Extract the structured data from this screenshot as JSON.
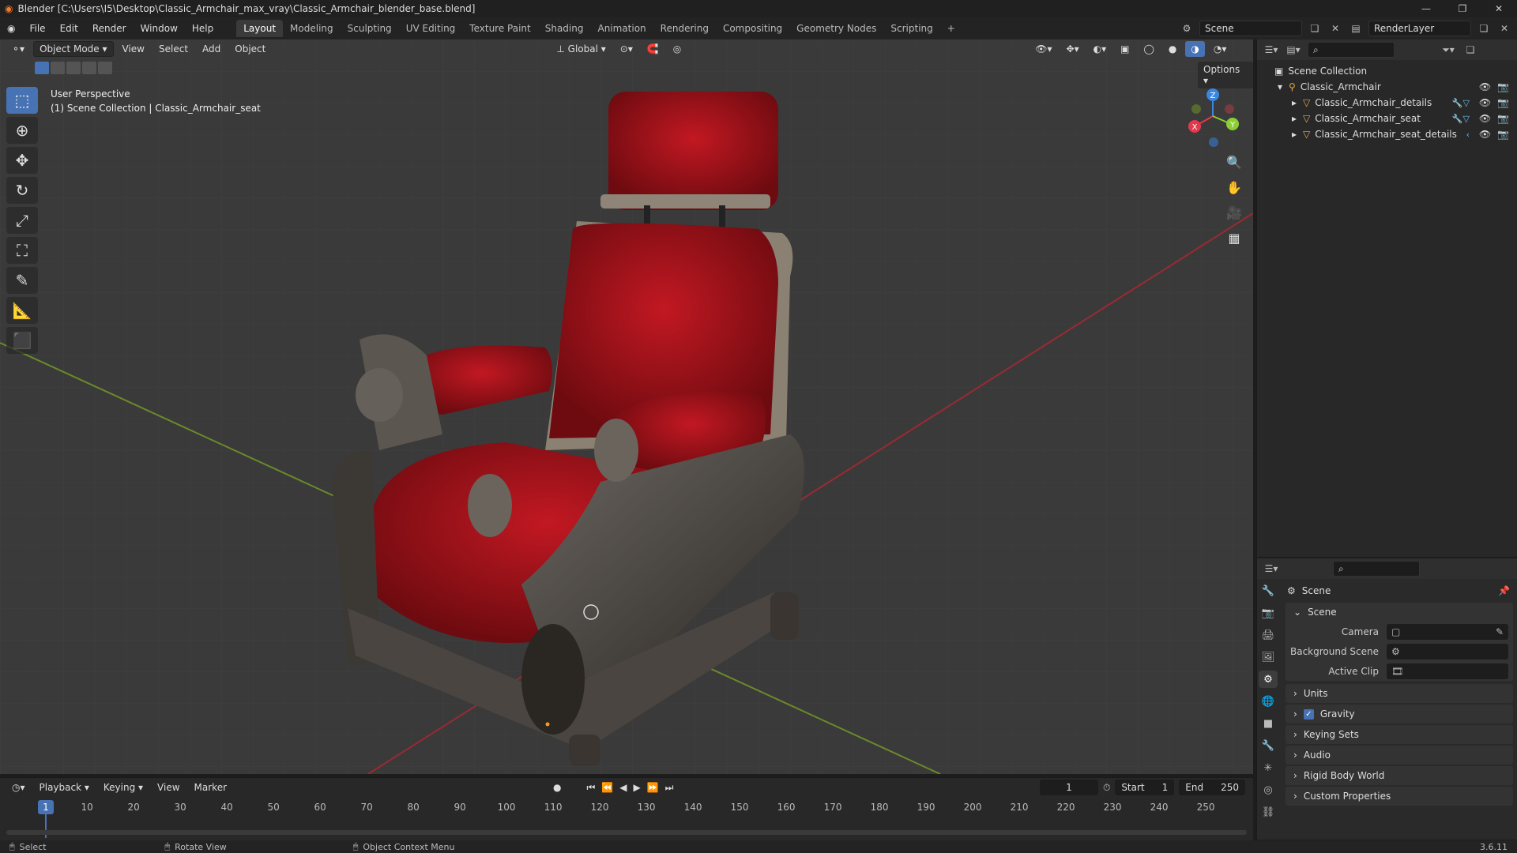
{
  "window": {
    "title": "Blender [C:\\Users\\I5\\Desktop\\Classic_Armchair_max_vray\\Classic_Armchair_blender_base.blend]",
    "controls": [
      "—",
      "❐",
      "✕"
    ]
  },
  "menu": [
    "File",
    "Edit",
    "Render",
    "Window",
    "Help"
  ],
  "workspaces": [
    "Layout",
    "Modeling",
    "Sculpting",
    "UV Editing",
    "Texture Paint",
    "Shading",
    "Animation",
    "Rendering",
    "Compositing",
    "Geometry Nodes",
    "Scripting"
  ],
  "workspace_add": "+",
  "scene_field": "Scene",
  "render_layer": "RenderLayer",
  "viewport": {
    "mode": "Object Mode",
    "menus": [
      "View",
      "Select",
      "Add",
      "Object"
    ],
    "transform": "Global",
    "options": "Options",
    "overlay_line1": "User Perspective",
    "overlay_line2": "(1) Scene Collection | Classic_Armchair_seat",
    "gizmo": {
      "x": "X",
      "y": "Y",
      "z": "Z"
    }
  },
  "outliner": {
    "root": "Scene Collection",
    "collection": "Classic_Armchair",
    "objects": [
      "Classic_Armchair_details",
      "Classic_Armchair_seat",
      "Classic_Armchair_seat_details"
    ]
  },
  "properties": {
    "breadcrumb": "Scene",
    "panel_scene": "Scene",
    "camera_label": "Camera",
    "bg_scene_label": "Background Scene",
    "active_clip_label": "Active Clip",
    "panels": [
      "Units",
      "Gravity",
      "Keying Sets",
      "Audio",
      "Rigid Body World",
      "Custom Properties"
    ]
  },
  "timeline": {
    "menus": [
      "Playback",
      "Keying",
      "View",
      "Marker"
    ],
    "current_frame": "1",
    "start_label": "Start",
    "start": "1",
    "end_label": "End",
    "end": "250",
    "ticks": [
      "10",
      "20",
      "30",
      "40",
      "50",
      "60",
      "70",
      "80",
      "90",
      "100",
      "110",
      "120",
      "130",
      "140",
      "150",
      "160",
      "170",
      "180",
      "190",
      "200",
      "210",
      "220",
      "230",
      "240",
      "250"
    ],
    "playhead": "1"
  },
  "status": {
    "select": "Select",
    "rotate": "Rotate View",
    "context": "Object Context Menu",
    "version": "3.6.11"
  },
  "colors": {
    "accent": "#4772b3",
    "velvet": "#a3141c",
    "x_axis": "#e23a4c",
    "y_axis": "#8bcf35",
    "z_axis": "#3b86e0"
  }
}
